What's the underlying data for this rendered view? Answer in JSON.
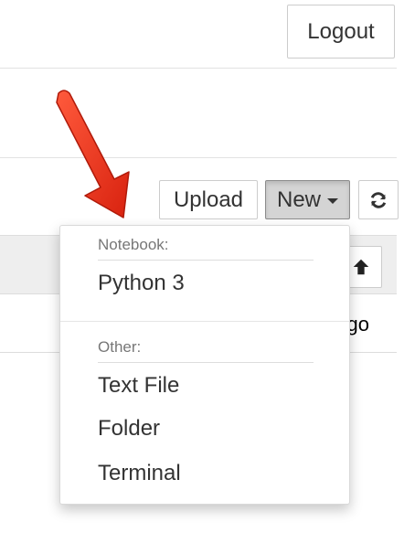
{
  "header": {
    "logout_label": "Logout"
  },
  "toolbar": {
    "upload_label": "Upload",
    "new_label": "New",
    "refresh_icon": "refresh-icon"
  },
  "list": {
    "sort_icon": "arrow-up-icon",
    "row_partial_text": "go"
  },
  "new_menu": {
    "sections": [
      {
        "header": "Notebook:",
        "items": [
          "Python 3"
        ]
      },
      {
        "header": "Other:",
        "items": [
          "Text File",
          "Folder",
          "Terminal"
        ]
      }
    ]
  },
  "annotation": {
    "arrow_color": "#e8321d"
  }
}
